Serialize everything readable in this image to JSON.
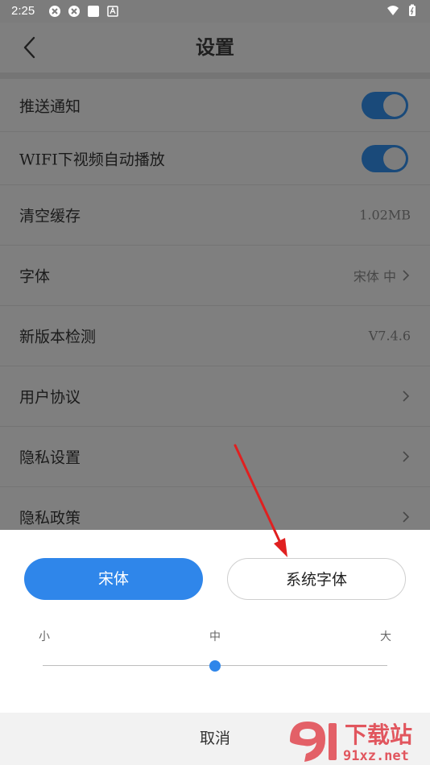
{
  "status_bar": {
    "time": "2:25"
  },
  "header": {
    "title": "设置"
  },
  "settings": [
    {
      "label": "推送通知",
      "type": "toggle",
      "on": true
    },
    {
      "label": "WIFI下视频自动播放",
      "type": "toggle",
      "on": true
    },
    {
      "label": "清空缓存",
      "type": "value",
      "value": "1.02MB"
    },
    {
      "label": "字体",
      "type": "nav",
      "value": "宋体 中"
    },
    {
      "label": "新版本检测",
      "type": "value",
      "value": "V7.4.6"
    },
    {
      "label": "用户协议",
      "type": "nav"
    },
    {
      "label": "隐私设置",
      "type": "nav"
    },
    {
      "label": "隐私政策",
      "type": "nav"
    }
  ],
  "font_sheet": {
    "options": [
      "宋体",
      "系统字体"
    ],
    "selected": "宋体",
    "size_labels": [
      "小",
      "中",
      "大"
    ],
    "size_selected": "中",
    "size_level_fraction": 0.5,
    "cancel_label": "取消"
  },
  "watermark": {
    "text": "91xz.net",
    "brand": "下载站",
    "color": "#e0464f"
  },
  "colors": {
    "accent": "#2f86ea",
    "toggle_on": "#1a4a7a",
    "arrow": "#e02020"
  }
}
